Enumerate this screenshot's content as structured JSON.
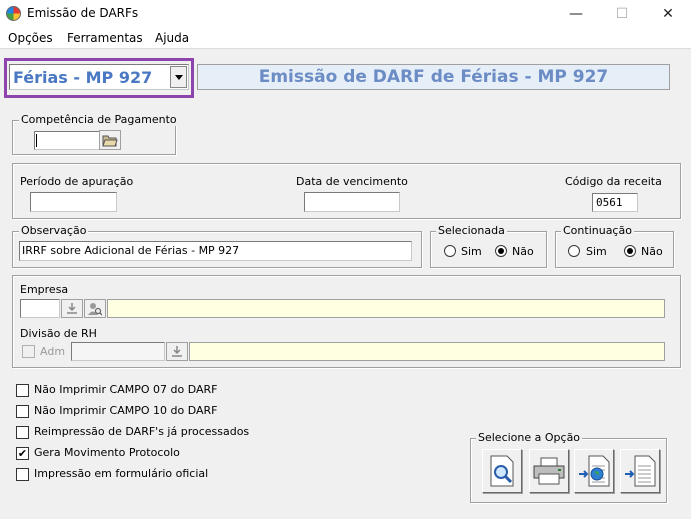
{
  "window": {
    "title": "Emissão de DARFs",
    "controls": {
      "minimize": "—",
      "maximize": "☐",
      "close": "✕"
    }
  },
  "menu": {
    "items": [
      "Opções",
      "Ferramentas",
      "Ajuda"
    ]
  },
  "header": {
    "darf_type": "Férias - MP 927",
    "banner": "Emissão de DARF de Férias - MP 927"
  },
  "competencia": {
    "label": "Competência de Pagamento",
    "value": ""
  },
  "periodo": {
    "label": "Período de apuração",
    "value": ""
  },
  "vencimento": {
    "label": "Data de vencimento",
    "value": ""
  },
  "codigo": {
    "label": "Código da receita",
    "value": "0561"
  },
  "observacao": {
    "label": "Observação",
    "value": "IRRF sobre Adicional de Férias - MP 927"
  },
  "selecionada": {
    "label": "Selecionada",
    "sim": "Sim",
    "nao": "Não",
    "selected": "Não"
  },
  "continuacao": {
    "label": "Continuação",
    "sim": "Sim",
    "nao": "Não",
    "selected": "Não"
  },
  "empresa": {
    "label": "Empresa",
    "code": "",
    "name": ""
  },
  "divisao": {
    "label": "Divisão de RH",
    "adm_label": "Adm",
    "code": "",
    "name": ""
  },
  "options": [
    {
      "label": "Não Imprimir CAMPO 07 do DARF",
      "checked": false
    },
    {
      "label": "Não Imprimir CAMPO 10 do DARF",
      "checked": false
    },
    {
      "label": "Reimpressão de DARF's já processados",
      "checked": false
    },
    {
      "label": "Gera Movimento Protocolo",
      "checked": true
    },
    {
      "label": "Impressão em formulário oficial",
      "checked": false
    }
  ],
  "action_group": {
    "label": "Selecione a Opção"
  },
  "colors": {
    "accent_border": "#8e44ad",
    "banner_text": "#6b8cc4",
    "dropdown_text": "#4a78c2"
  }
}
